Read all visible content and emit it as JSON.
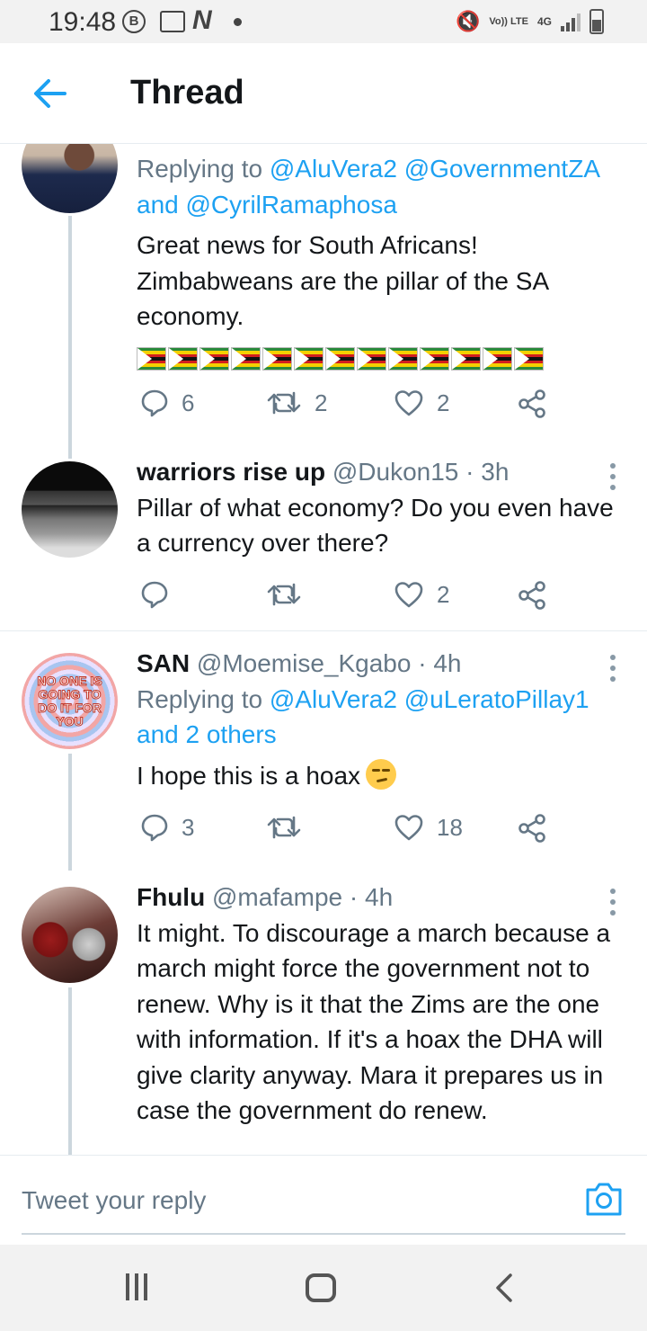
{
  "status_bar": {
    "time": "19:48",
    "b_badge": "B",
    "n_badge": "N",
    "volte": "Vo)) LTE",
    "network": "4G"
  },
  "header": {
    "title": "Thread"
  },
  "tweets": [
    {
      "replying_prefix": "Replying to ",
      "replying_to": "@AluVera2 @GovernmentZA",
      "replying_line2": "and @CyrilRamaphosa",
      "text": "Great news for South Africans! Zimbabweans are the pillar of the SA economy.",
      "flag_count": 13,
      "replies": "6",
      "retweets": "2",
      "likes": "2"
    },
    {
      "name": "warriors rise up",
      "handle": "@Dukon15 · 3h",
      "text": "Pillar of what economy? Do you even have a currency over there?",
      "replies": "",
      "retweets": "",
      "likes": "2"
    },
    {
      "name": "SAN",
      "handle": "@Moemise_Kgabo · 4h",
      "avatar_text": "NO ONE IS GOING TO DO IT FOR YOU",
      "replying_prefix": "Replying to ",
      "replying_to": "@AluVera2 @uLeratoPillay1",
      "replying_line2": "and 2 others",
      "text": "I hope this is a hoax",
      "emoji": "smirking-face",
      "replies": "3",
      "retweets": "",
      "likes": "18"
    },
    {
      "name": "Fhulu",
      "handle": "@mafampe · 4h",
      "text": "It might. To discourage a march because a march might force the government not to renew. Why is it that the Zims are the one with information. If it's a hoax the DHA will give clarity anyway. Mara it prepares us in case the government do renew."
    }
  ],
  "reply_bar": {
    "placeholder": "Tweet your reply"
  },
  "colors": {
    "accent": "#1da1f2",
    "text": "#14171a",
    "muted": "#657786",
    "line": "#ccd6dd"
  }
}
